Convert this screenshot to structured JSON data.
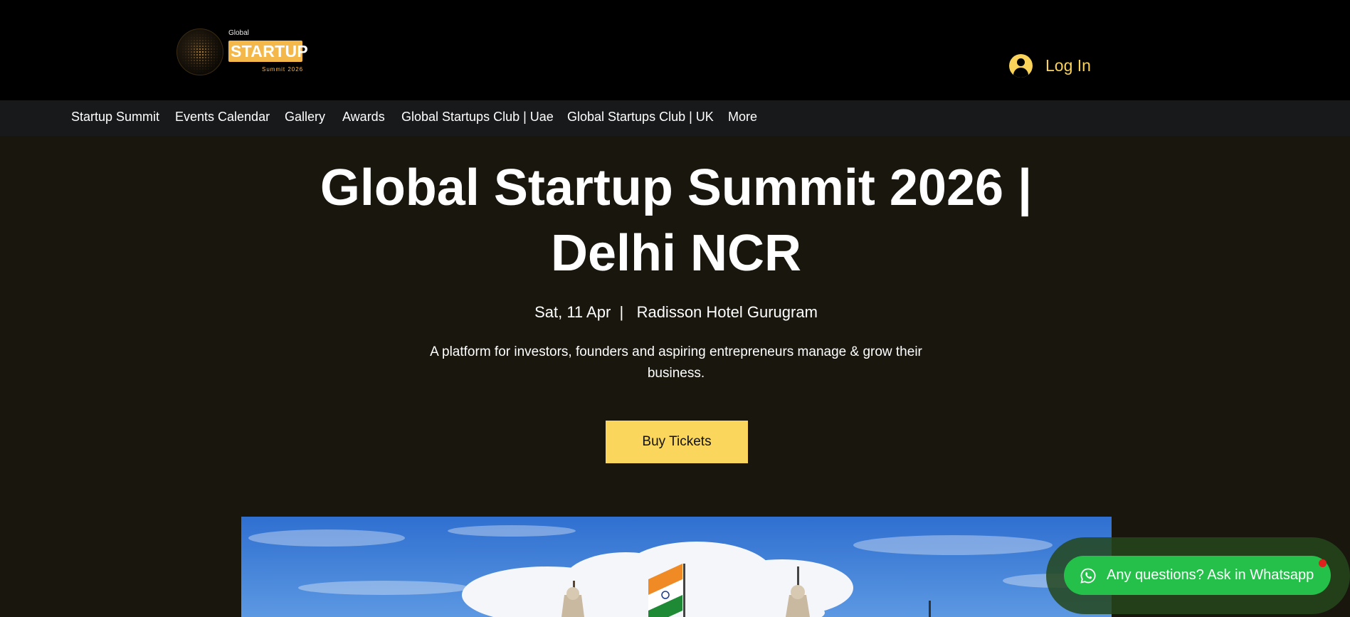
{
  "logo": {
    "small_text": "Global",
    "main_text": "STARTUP",
    "sub_text": "Summit 2026",
    "accent_color": "#f4b84a"
  },
  "header": {
    "login_label": "Log In",
    "login_icon": "user-avatar-icon"
  },
  "nav": {
    "items": [
      {
        "label": "Startup Summit"
      },
      {
        "label": "Events Calendar"
      },
      {
        "label": "Gallery"
      },
      {
        "label": "Awards"
      },
      {
        "label": "Global Startups Club | Uae"
      },
      {
        "label": "Global Startups Club | UK"
      },
      {
        "label": "More"
      }
    ]
  },
  "hero": {
    "title_line1": "Global Startup Summit 2026 |",
    "title_line2": "Delhi NCR",
    "meta": "Sat, 11 Apr  |   Radisson Hotel Gurugram",
    "description": "A platform for investors, founders and aspiring entrepreneurs manage & grow their business.",
    "cta_label": "Buy Tickets",
    "cta_color": "#fad65c"
  },
  "whatsapp": {
    "label": "Any questions? Ask in Whatsapp",
    "icon": "whatsapp-icon",
    "color": "#24c04a"
  },
  "colors": {
    "page_bg": "#19160d",
    "header_bg": "#000000",
    "nav_bg": "#18191b"
  }
}
